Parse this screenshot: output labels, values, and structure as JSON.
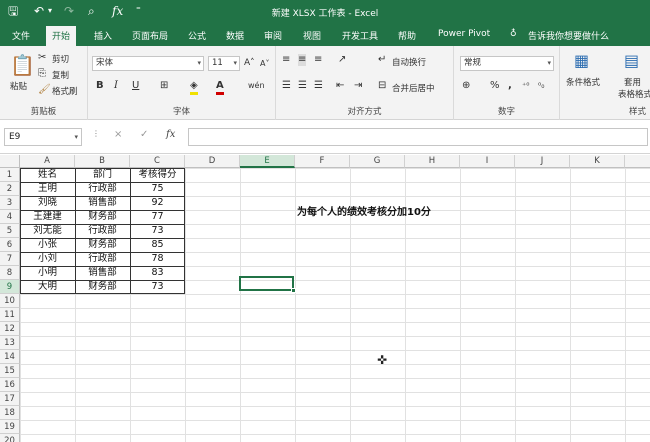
{
  "titlebar": {
    "title": "新建 XLSX 工作表 - Excel",
    "save_icon": "save-icon",
    "fx": "fx"
  },
  "tabs": [
    "文件",
    "开始",
    "插入",
    "页面布局",
    "公式",
    "数据",
    "审阅",
    "视图",
    "开发工具",
    "帮助",
    "Power Pivot"
  ],
  "active_tab": "开始",
  "tellme": "告诉我你想要做什么",
  "ribbon": {
    "clipboard": {
      "label": "剪贴板",
      "paste": "粘贴",
      "cut": "剪切",
      "copy": "复制",
      "painter": "格式刷"
    },
    "font": {
      "label": "字体",
      "name": "宋体",
      "size": "11",
      "bold": "B",
      "italic": "I",
      "underline": "U"
    },
    "align": {
      "label": "对齐方式",
      "wrap": "自动换行",
      "merge": "合并后居中"
    },
    "number": {
      "label": "数字",
      "format": "常规",
      "percent": "%",
      "comma": ","
    },
    "styles": {
      "label": "样式",
      "cond": "条件格式",
      "table1": "套用",
      "table2": "表格格式"
    }
  },
  "formula_bar": {
    "namebox": "E9",
    "value": "",
    "fx": "fx",
    "cancel": "×",
    "enter": "✓"
  },
  "columns": [
    "A",
    "B",
    "C",
    "D",
    "E",
    "F",
    "G",
    "H",
    "I",
    "J",
    "K",
    "L"
  ],
  "rows": [
    "1",
    "2",
    "3",
    "4",
    "5",
    "6",
    "7",
    "8",
    "9",
    "10",
    "11",
    "12",
    "13",
    "14",
    "15",
    "16",
    "17",
    "18",
    "19",
    "20"
  ],
  "selected_cell": {
    "col": "E",
    "row": "9"
  },
  "table": {
    "headers": [
      "姓名",
      "部门",
      "考核得分"
    ],
    "rows": [
      [
        "王明",
        "行政部",
        "75"
      ],
      [
        "刘晓",
        "销售部",
        "92"
      ],
      [
        "王建建",
        "财务部",
        "77"
      ],
      [
        "刘无能",
        "行政部",
        "73"
      ],
      [
        "小张",
        "财务部",
        "85"
      ],
      [
        "小刘",
        "行政部",
        "78"
      ],
      [
        "小明",
        "销售部",
        "83"
      ],
      [
        "大明",
        "财务部",
        "73"
      ]
    ]
  },
  "note": "为每个人的绩效考核分加10分"
}
